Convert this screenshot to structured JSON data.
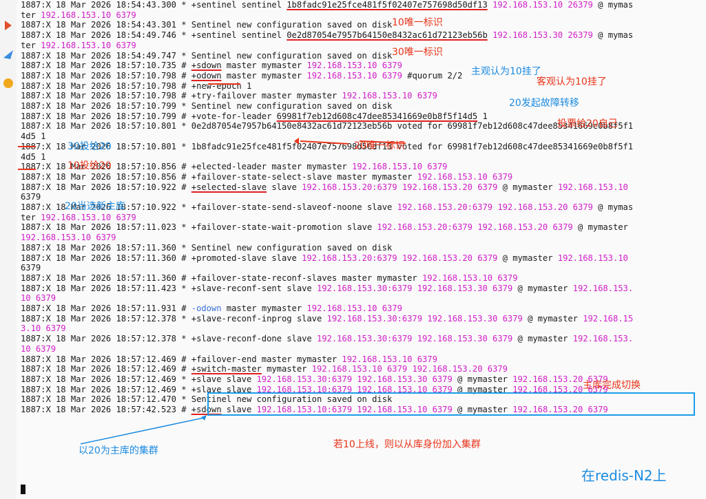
{
  "sidebar_icons": [
    {
      "name": "app-icon-red"
    },
    {
      "name": "app-icon-blue"
    },
    {
      "name": "app-icon-yellow"
    }
  ],
  "lines": [
    {
      "text": "1887:X 18 Mar 2026 18:54:43.300 * +sentinel sentinel 1b8fadc91e25fce481f5f02407e757698d50df13 192.168.153.10 26379 @ mymas"
    },
    {
      "text": "ter 192.168.153.10 6379"
    },
    {
      "text": "1887:X 18 Mar 2026 18:54:43.301 * Sentinel new configuration saved on disk"
    },
    {
      "text": "1887:X 18 Mar 2026 18:54:49.746 * +sentinel sentinel 0e2d87054e7957b64150e8432ac61d72123eb56b 192.168.153.30 26379 @ mymas"
    },
    {
      "text": "ter 192.168.153.10 6379"
    },
    {
      "text": "1887:X 18 Mar 2026 18:54:49.747 * Sentinel new configuration saved on disk"
    },
    {
      "text": "1887:X 18 Mar 2026 18:57:10.735 # +sdown master mymaster 192.168.153.10 6379"
    },
    {
      "text": "1887:X 18 Mar 2026 18:57:10.798 # +odown master mymaster 192.168.153.10 6379 #quorum 2/2"
    },
    {
      "text": "1887:X 18 Mar 2026 18:57:10.798 # +new-epoch 1"
    },
    {
      "text": "1887:X 18 Mar 2026 18:57:10.798 # +try-failover master mymaster 192.168.153.10 6379"
    },
    {
      "text": "1887:X 18 Mar 2026 18:57:10.799 * Sentinel new configuration saved on disk"
    },
    {
      "text": "1887:X 18 Mar 2026 18:57:10.799 # +vote-for-leader 69981f7eb12d608c47dee85341669e0b8f5f14d5 1"
    },
    {
      "text": "1887:X 18 Mar 2026 18:57:10.801 * 0e2d87054e7957b64150e8432ac61d72123eb56b voted for 69981f7eb12d608c47dee85341669e0b8f5f1"
    },
    {
      "text": "4d5 1"
    },
    {
      "text": "1887:X 18 Mar 2026 18:57:10.801 * 1b8fadc91e25fce481f5f02407e757698d50df13 voted for 69981f7eb12d608c47dee85341669e0b8f5f1"
    },
    {
      "text": "4d5 1"
    },
    {
      "text": "1887:X 18 Mar 2026 18:57:10.856 # +elected-leader master mymaster 192.168.153.10 6379"
    },
    {
      "text": "1887:X 18 Mar 2026 18:57:10.856 # +failover-state-select-slave master mymaster 192.168.153.10 6379"
    },
    {
      "text": "1887:X 18 Mar 2026 18:57:10.922 # +selected-slave slave 192.168.153.20:6379 192.168.153.20 6379 @ mymaster 192.168.153.10"
    },
    {
      "text": "6379"
    },
    {
      "text": "1887:X 18 Mar 2026 18:57:10.922 * +failover-state-send-slaveof-noone slave 192.168.153.20:6379 192.168.153.20 6379 @ mymas"
    },
    {
      "text": "ter 192.168.153.10 6379"
    },
    {
      "text": "1887:X 18 Mar 2026 18:57:11.023 * +failover-state-wait-promotion slave 192.168.153.20:6379 192.168.153.20 6379 @ mymaster"
    },
    {
      "text": "192.168.153.10 6379"
    },
    {
      "text": "1887:X 18 Mar 2026 18:57:11.360 * Sentinel new configuration saved on disk"
    },
    {
      "text": "1887:X 18 Mar 2026 18:57:11.360 # +promoted-slave slave 192.168.153.20:6379 192.168.153.20 6379 @ mymaster 192.168.153.10"
    },
    {
      "text": "6379"
    },
    {
      "text": "1887:X 18 Mar 2026 18:57:11.360 # +failover-state-reconf-slaves master mymaster 192.168.153.10 6379"
    },
    {
      "text": "1887:X 18 Mar 2026 18:57:11.423 * +slave-reconf-sent slave 192.168.153.30:6379 192.168.153.30 6379 @ mymaster 192.168.153."
    },
    {
      "text": "10 6379"
    },
    {
      "text": "1887:X 18 Mar 2026 18:57:11.931 # -odown master mymaster 192.168.153.10 6379"
    },
    {
      "text": "1887:X 18 Mar 2026 18:57:12.378 * +slave-reconf-inprog slave 192.168.153.30:6379 192.168.153.30 6379 @ mymaster 192.168.15"
    },
    {
      "text": "3.10 6379"
    },
    {
      "text": "1887:X 18 Mar 2026 18:57:12.378 * +slave-reconf-done slave 192.168.153.30:6379 192.168.153.30 6379 @ mymaster 192.168.153."
    },
    {
      "text": "10 6379"
    },
    {
      "text": "1887:X 18 Mar 2026 18:57:12.469 # +failover-end master mymaster 192.168.153.10 6379"
    },
    {
      "text": "1887:X 18 Mar 2026 18:57:12.469 # +switch-master mymaster 192.168.153.10 6379 192.168.153.20 6379"
    },
    {
      "text": "1887:X 18 Mar 2026 18:57:12.469 * +slave slave 192.168.153.30:6379 192.168.153.30 6379 @ mymaster 192.168.153.20 6379"
    },
    {
      "text": "1887:X 18 Mar 2026 18:57:12.469 * +slave slave 192.168.153.10:6379 192.168.153.10 6379 @ mymaster 192.168.153.20 6379"
    },
    {
      "text": "1887:X 18 Mar 2026 18:57:12.470 * Sentinel new configuration saved on disk"
    },
    {
      "text": "1887:X 18 Mar 2026 18:57:42.523 # +sdown slave 192.168.153.10:6379 192.168.153.10 6379 @ mymaster 192.168.153.20 6379"
    }
  ],
  "annotations": {
    "a10_unique_id": "10唯一标识",
    "a30_unique_id": "30唯一标识",
    "subjective_down": "主观认为10挂了",
    "objective_down": "客观认为10挂了",
    "start_failover": "20发起故障转移",
    "vote_self": "投票给20自己",
    "a20_unique_id": "20唯一标识",
    "a30_votes_20": "30投给20",
    "a10_votes_20": "10投给20",
    "selected_new_master": "20当选新主库",
    "switch_done": "主库完成切换",
    "cluster_with_20": "以20为主库的集群",
    "rejoin_as_slave": "若10上线，则以从库身份加入集群",
    "on_node": "在redis-N2上"
  },
  "colors": {
    "ip": "#d11ec8",
    "annotation_red": "#e8341a",
    "annotation_blue": "#1c8be0",
    "box_blue": "#1c9be8"
  }
}
